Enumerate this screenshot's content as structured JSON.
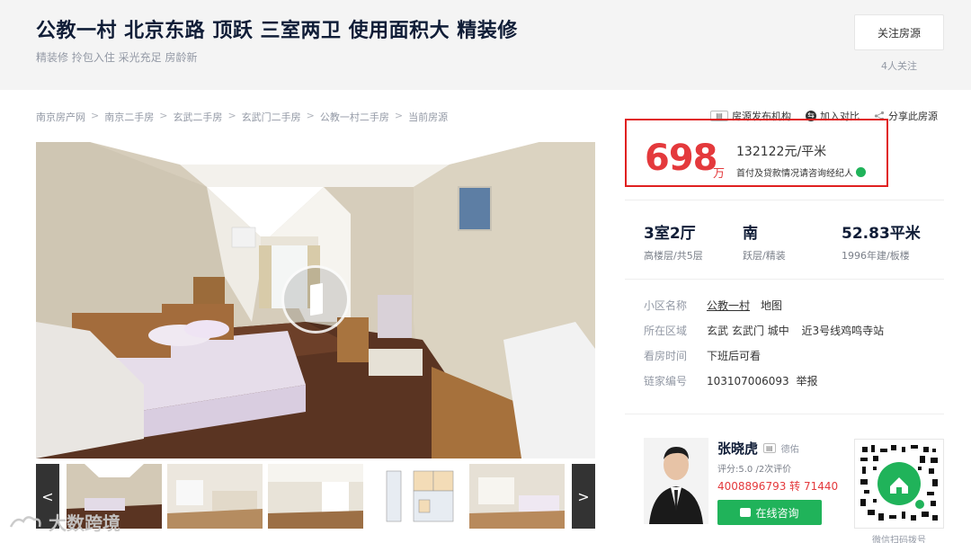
{
  "header": {
    "title": "公教一村 北京东路 顶跃 三室两卫 使用面积大 精装修",
    "tags": "精装修 拎包入住 采光充足 房龄新",
    "follow_label": "关注房源",
    "follow_count": "4人关注"
  },
  "breadcrumb": {
    "items": [
      "南京房产网",
      "南京二手房",
      "玄武二手房",
      "玄武门二手房",
      "公教一村二手房",
      "当前房源"
    ],
    "separator": ">"
  },
  "top_actions": {
    "publisher": "房源发布机构",
    "compare": "加入对比",
    "share": "分享此房源"
  },
  "price": {
    "total": "698",
    "total_unit": "万",
    "unit_price": "132122元/平米",
    "note": "首付及贷款情况请咨询经纪人"
  },
  "stats": [
    {
      "main": "3室2厅",
      "sub": "高楼层/共5层"
    },
    {
      "main": "南",
      "sub": "跃层/精装"
    },
    {
      "main": "52.83平米",
      "sub": "1996年建/板楼"
    }
  ],
  "info": {
    "community_label": "小区名称",
    "community_value": "公教一村",
    "map_label": "地图",
    "area_label": "所在区域",
    "district": "玄武",
    "subdistrict": "玄武门",
    "zone": "城中",
    "subway": "近3号线鸡鸣寺站",
    "viewing_label": "看房时间",
    "viewing_value": "下班后可看",
    "id_label": "链家编号",
    "id_value": "103107006093",
    "report_label": "举报"
  },
  "agent": {
    "name": "张晓虎",
    "badge": "德佑",
    "brand": "德佑",
    "score": "评分:5.0 /2次评价",
    "phone": "4008896793 转 71440",
    "consult_label": "在线咨询",
    "qr_caption": "微信扫码拨号"
  },
  "thumbs": {
    "prev": "<",
    "next": ">"
  },
  "watermark": "大数跨境",
  "colors": {
    "price_red": "#e4393c",
    "box_red": "#e02020",
    "consult_green": "#20b35a",
    "title_navy": "#101d37"
  }
}
